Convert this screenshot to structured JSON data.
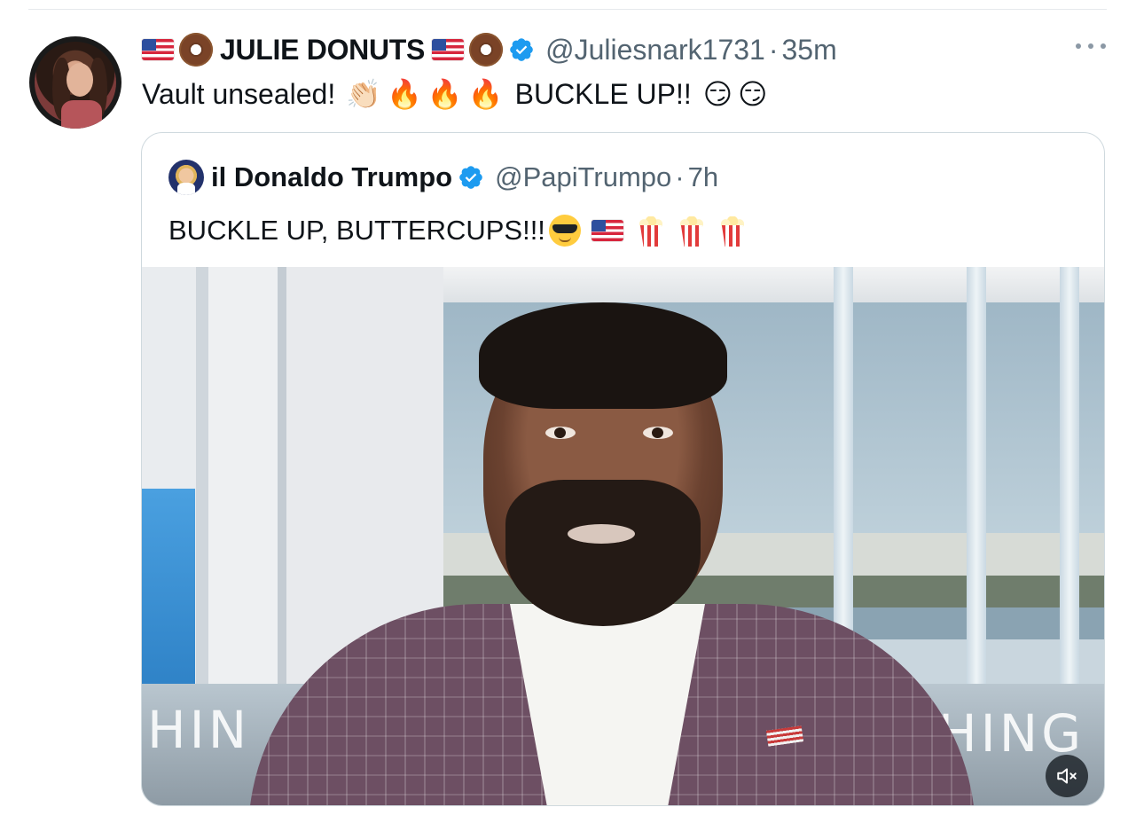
{
  "tweet": {
    "author_name": "JULIE DONUTS",
    "handle": "@Juliesnark1731",
    "separator": "·",
    "time": "35m",
    "text_part1": "Vault unsealed!",
    "emoji_clap": "👏🏻",
    "emoji_fire": "🔥",
    "text_part2": "BUCKLE UP!!",
    "emoji_smirk": "😏",
    "icons": [
      "us-flag-icon",
      "donut-icon",
      "verified-badge-icon",
      "more-options-icon"
    ]
  },
  "quoted_tweet": {
    "author_name": "il Donaldo Trumpo",
    "handle": "@PapiTrumpo",
    "separator": "·",
    "time": "7h",
    "text": "BUCKLE UP, BUTTERCUPS!!!",
    "icons": [
      "sunglasses-emoji-icon",
      "us-flag-icon",
      "popcorn-icon",
      "verified-badge-icon"
    ]
  },
  "video": {
    "caption_left": "HIN",
    "caption_right": "HING",
    "mute_icon": "speaker-muted-icon"
  },
  "colors": {
    "text_primary": "#0f1419",
    "text_secondary": "#536471",
    "verified_blue": "#1d9bf0",
    "border": "#cfd9de"
  }
}
